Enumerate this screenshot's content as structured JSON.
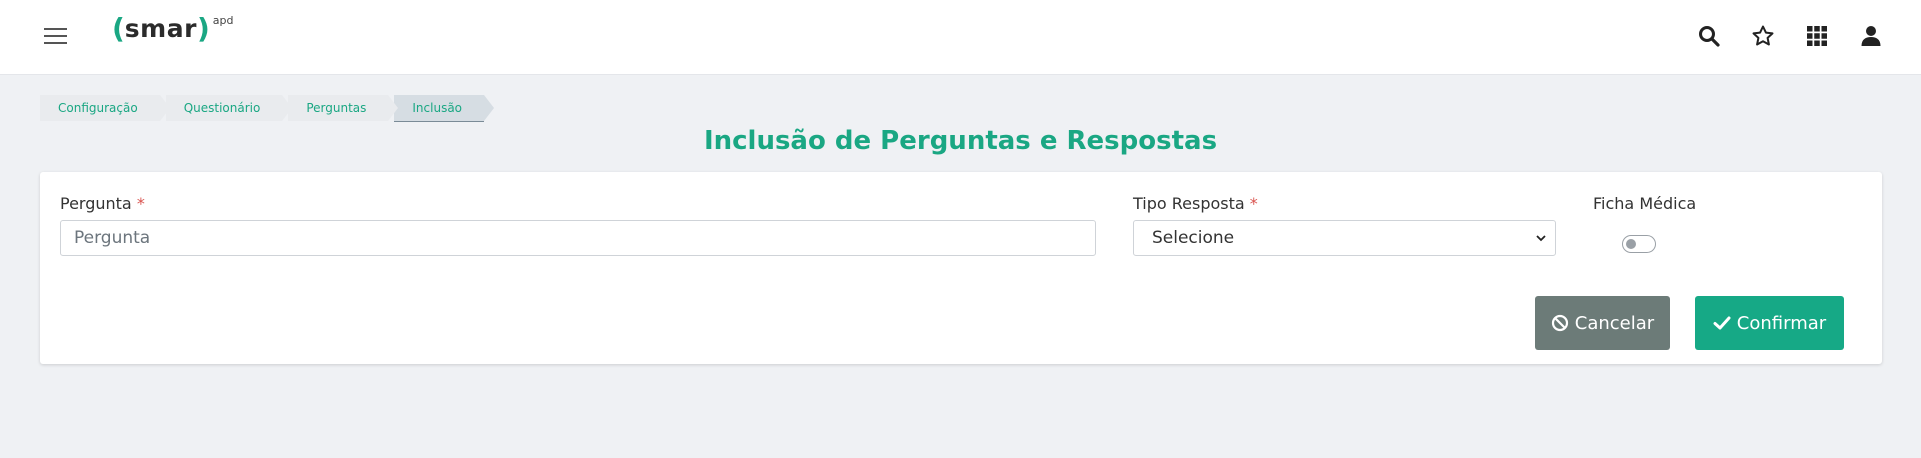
{
  "header": {
    "menu_icon": "hamburger-icon",
    "logo": {
      "open_paren": "(",
      "word": "smar",
      "close_paren": ")",
      "sup": "apd"
    },
    "icons": [
      "search-icon",
      "star-icon",
      "apps-grid-icon",
      "user-icon"
    ]
  },
  "breadcrumb": [
    "Configuração",
    "Questionário",
    "Perguntas",
    "Inclusão"
  ],
  "page_title": "Inclusão de Perguntas e Respostas",
  "form": {
    "pergunta": {
      "label": "Pergunta",
      "required_mark": "*",
      "placeholder": "Pergunta",
      "value": ""
    },
    "tipo_resposta": {
      "label": "Tipo Resposta",
      "required_mark": "*",
      "selected": "Selecione"
    },
    "ficha_medica": {
      "label": "Ficha Médica",
      "checked": false
    }
  },
  "buttons": {
    "cancel": "Cancelar",
    "confirm": "Confirmar"
  },
  "colors": {
    "accent": "#1aa783",
    "cancel": "#6c7b78",
    "confirm": "#16a986",
    "background": "#eff1f4"
  }
}
